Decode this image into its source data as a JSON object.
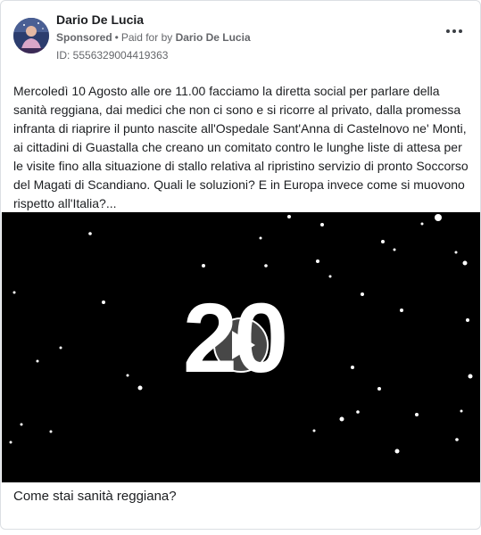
{
  "post": {
    "author": "Dario De Lucia",
    "sponsored_label": "Sponsored",
    "separator": "•",
    "paid_for_prefix": "Paid for by",
    "payer": "Dario De Lucia",
    "ad_id": "ID: 5556329004419363",
    "body_text": "Mercoledì 10 Agosto alle ore 11.00 facciamo la diretta social per parlare della sanità reggiana, dai medici che non ci sono e si ricorre al privato, dalla promessa infranta di riaprire il punto nascite all'Ospedale Sant'Anna di Castelnovo ne' Monti, ai cittadini di Guastalla che creano un comitato contro le lunghe liste di attesa per le visite fino alla situazione di stallo relativa al ripristino servizio di pronto Soccorso del Magati di Scandiano. Quali le soluzioni? E in Europa invece come si muovono rispetto all'Italia?...",
    "video_overlay_text": "20",
    "caption": "Come stai sanità reggiana?"
  },
  "icons": {
    "more": "more-options-icon",
    "play": "play-icon"
  },
  "colors": {
    "text": "#1c1e21",
    "secondary_text": "#65676b",
    "video_background": "#000000",
    "overlay_text": "#ffffff"
  }
}
